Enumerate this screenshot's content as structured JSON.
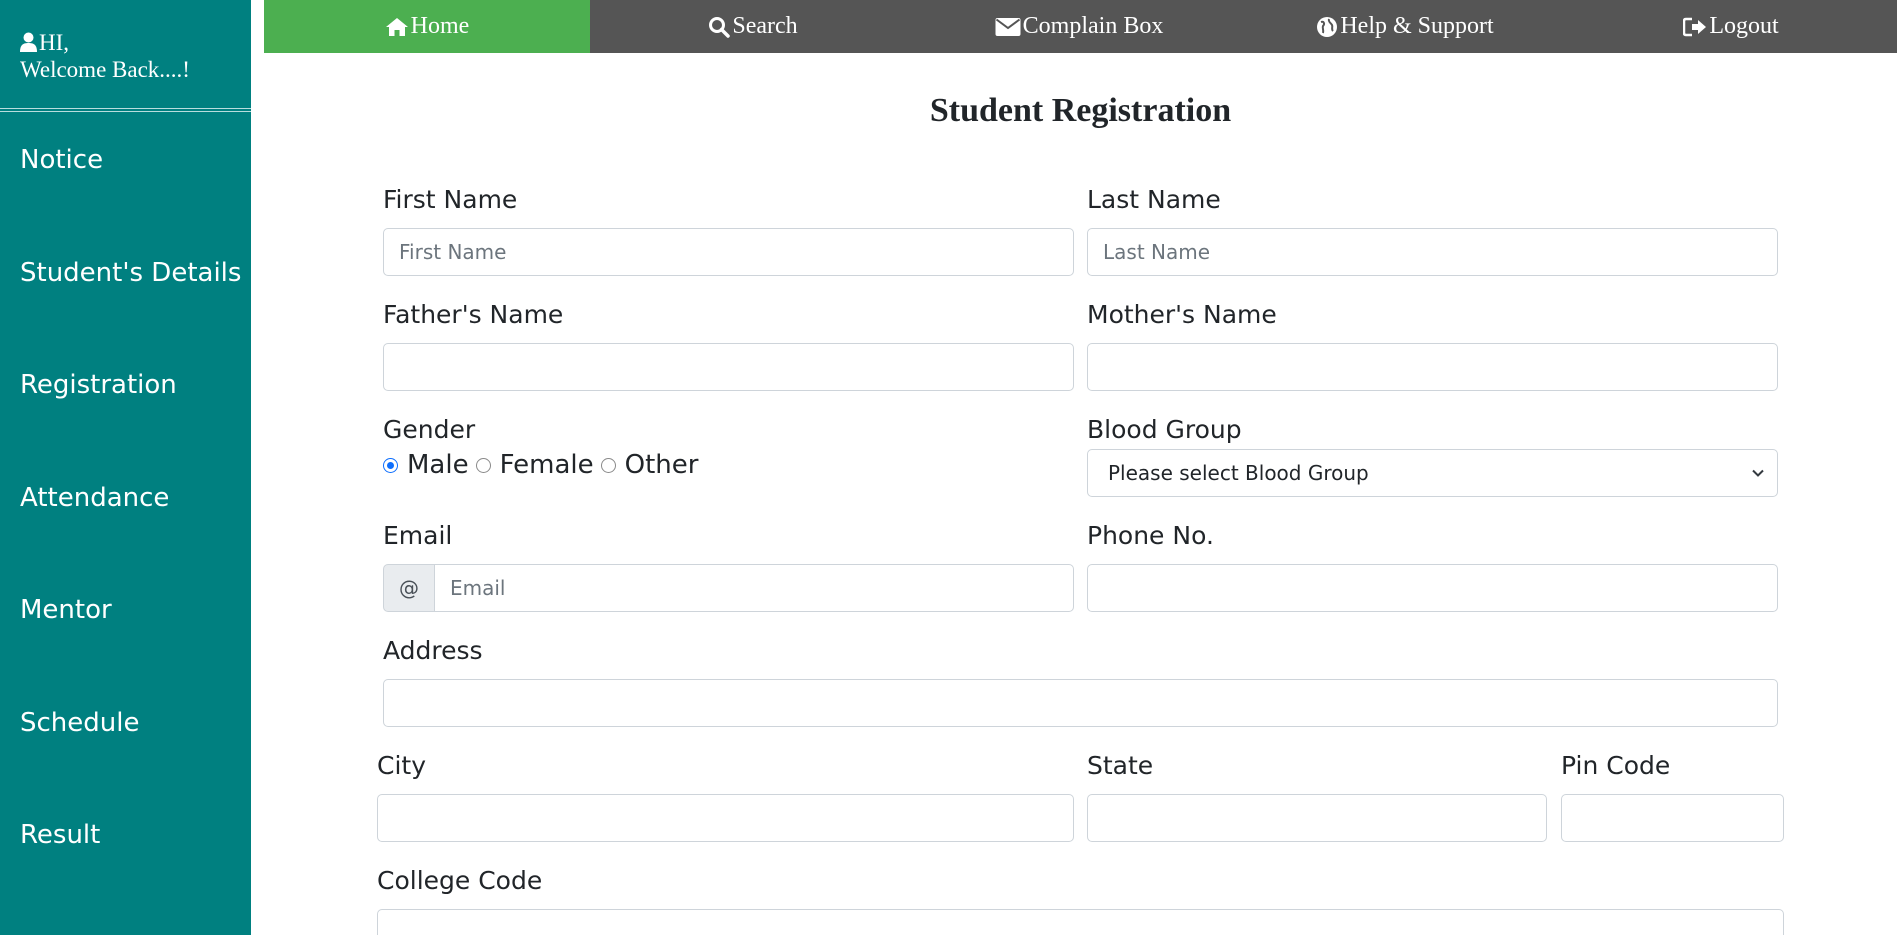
{
  "sidebar": {
    "greeting_line1": "HI,",
    "greeting_line2": "Welcome Back....!",
    "items": [
      {
        "label": "Notice"
      },
      {
        "label": "Student's Details"
      },
      {
        "label": "Registration"
      },
      {
        "label": "Attendance"
      },
      {
        "label": "Mentor"
      },
      {
        "label": "Schedule"
      },
      {
        "label": "Result"
      }
    ]
  },
  "nav": {
    "items": [
      {
        "label": "Home",
        "icon": "home-icon",
        "active": true
      },
      {
        "label": "Search",
        "icon": "search-icon"
      },
      {
        "label": "Complain Box",
        "icon": "envelope-icon"
      },
      {
        "label": "Help & Support",
        "icon": "globe-icon"
      },
      {
        "label": "Logout",
        "icon": "logout-icon"
      }
    ]
  },
  "form": {
    "title": "Student Registration",
    "first_name": {
      "label": "First Name",
      "placeholder": "First Name",
      "value": ""
    },
    "last_name": {
      "label": "Last Name",
      "placeholder": "Last Name",
      "value": ""
    },
    "father_name": {
      "label": "Father's Name",
      "value": ""
    },
    "mother_name": {
      "label": "Mother's Name",
      "value": ""
    },
    "gender": {
      "label": "Gender",
      "options": [
        "Male",
        "Female",
        "Other"
      ],
      "selected": "Male"
    },
    "blood_group": {
      "label": "Blood Group",
      "selected": "Please select Blood Group"
    },
    "email": {
      "label": "Email",
      "prefix": "@",
      "placeholder": "Email",
      "value": ""
    },
    "phone": {
      "label": "Phone No.",
      "value": ""
    },
    "address": {
      "label": "Address",
      "value": ""
    },
    "city": {
      "label": "City",
      "value": ""
    },
    "state": {
      "label": "State",
      "value": ""
    },
    "pin_code": {
      "label": "Pin Code",
      "value": ""
    },
    "college_code": {
      "label": "College Code",
      "value": ""
    }
  },
  "colors": {
    "sidebar_bg": "#008080",
    "nav_bg": "#555555",
    "nav_active": "#4caf50",
    "radio_accent": "#0d6efd"
  }
}
